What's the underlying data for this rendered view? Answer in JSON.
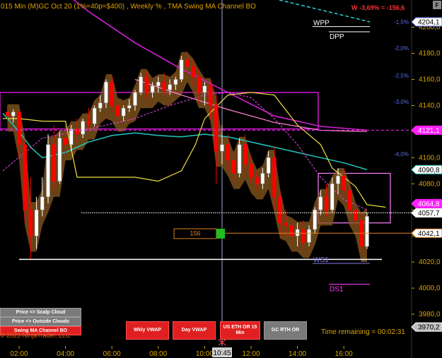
{
  "title": "015 Min (M)GC  Oct 20 (1%=40p=$400) , Weekly % , TMA Swing MA Channel BO",
  "performance": "W -3,69% = -156,6",
  "corner_label": "F",
  "copyright": "© 2023 NinjaTrader, LLC",
  "time_remaining": "Time remaining = 00:02:31",
  "buttons": {
    "scalp_cloud": "Price <> Scalp Cloud",
    "outside_clouds": "Price <> Outside Clouds",
    "swing_ma": "Swing MA Channel BO",
    "wkly_vwap": "Wkly VWAP",
    "day_vwap": "Day VWAP",
    "us_eth": "US ETH OR 15 Min",
    "gc_rth": "GC RTH OR"
  },
  "colors": {
    "background": "#000000",
    "axis_text": "#d9a400",
    "bull_candle": "#ffffff",
    "bear_candle": "#ff0000",
    "cloud": "#8b5a1e",
    "yellow_line": "#f0e040",
    "cyan_line": "#20c8c0",
    "magenta_line": "#d020d0",
    "pct_text": "#5b6cf0"
  },
  "chart_data": {
    "type": "candlestick",
    "y_ticks": [
      3980,
      4000,
      4020,
      4040,
      4060,
      4080,
      4100,
      4120,
      4140,
      4160,
      4180,
      4200
    ],
    "y_tick_labels": [
      "3980,0",
      "4000,0",
      "4020,0",
      "4040,0",
      "4060,0",
      "4080,0",
      "4100,0",
      "4120,0",
      "4140,0",
      "4160,0",
      "4180,0",
      "4200,0"
    ],
    "x_tick_labels": [
      "02:00",
      "04:00",
      "06:00",
      "08:00",
      "10:00",
      "12:00",
      "14:00",
      "16:00"
    ],
    "x_tick_hours": [
      2,
      4,
      6,
      8,
      10,
      12,
      14,
      16
    ],
    "crosshair": {
      "time": "10:45",
      "hour": 10.75
    },
    "price_flags": [
      {
        "label": "4204,1",
        "value": 4204.1,
        "bg": "#ffffff",
        "fg": "#000000",
        "border": "#5b6cf0"
      },
      {
        "label": "4121,1",
        "value": 4121.1,
        "bg": "#ff20ff",
        "fg": "#ffffff",
        "border": "#ff20ff"
      },
      {
        "label": "4090,8",
        "value": 4090.8,
        "bg": "#ffffff",
        "fg": "#000000",
        "border": "#20c8c0"
      },
      {
        "label": "4064,8",
        "value": 4064.8,
        "bg": "#ff20ff",
        "fg": "#ffffff",
        "border": "#ff20ff"
      },
      {
        "label": "4057,7",
        "value": 4057.7,
        "bg": "#ffffff",
        "fg": "#000000",
        "border": "#ffffff"
      },
      {
        "label": "4042,1",
        "value": 4042.1,
        "bg": "#ffffff",
        "fg": "#000000",
        "border": "#e08020"
      },
      {
        "label": "3970,2",
        "value": 3970.2,
        "bg": "#c0c0c0",
        "fg": "#000000",
        "border": "#ffffff"
      }
    ],
    "percent_levels": [
      {
        "label": "-1,5%",
        "value": 4204.1
      },
      {
        "label": "-2,0%",
        "value": 4184.0
      },
      {
        "label": "-2,5%",
        "value": 4163.0
      },
      {
        "label": "-3,0%",
        "value": 4143.0
      },
      {
        "label": "-4,0%",
        "value": 4103.0
      }
    ],
    "levels": [
      {
        "label": "WPP",
        "value": 4200.5,
        "color": "#ffffff"
      },
      {
        "label": "DPP",
        "value": 4196.5,
        "color": "#ffffff"
      },
      {
        "label": "WS1",
        "value": 4019.0,
        "color": "#8a7af0"
      },
      {
        "label": "DS1",
        "value": 4003.0,
        "color": "#ff40ff"
      }
    ],
    "range_box_label": "156",
    "candles": [
      {
        "t": 1.5,
        "o": 4135,
        "h": 4140,
        "c": 4132,
        "l": 4128
      },
      {
        "t": 1.75,
        "o": 4132,
        "h": 4137,
        "c": 4135,
        "l": 4127
      },
      {
        "t": 2.0,
        "o": 4135,
        "h": 4137,
        "c": 4110,
        "l": 4100
      },
      {
        "t": 2.25,
        "o": 4110,
        "h": 4115,
        "c": 4060,
        "l": 4050
      },
      {
        "t": 2.5,
        "o": 4060,
        "h": 4085,
        "c": 4040,
        "l": 4022
      },
      {
        "t": 2.75,
        "o": 4040,
        "h": 4070,
        "c": 4060,
        "l": 4030
      },
      {
        "t": 3.0,
        "o": 4060,
        "h": 4085,
        "c": 4070,
        "l": 4055
      },
      {
        "t": 3.25,
        "o": 4070,
        "h": 4118,
        "c": 4110,
        "l": 4065
      },
      {
        "t": 3.5,
        "o": 4110,
        "h": 4125,
        "c": 4082,
        "l": 4075
      },
      {
        "t": 3.75,
        "o": 4082,
        "h": 4120,
        "c": 4115,
        "l": 4080
      },
      {
        "t": 4.0,
        "o": 4115,
        "h": 4125,
        "c": 4110,
        "l": 4100
      },
      {
        "t": 4.25,
        "o": 4110,
        "h": 4125,
        "c": 4122,
        "l": 4105
      },
      {
        "t": 4.5,
        "o": 4122,
        "h": 4130,
        "c": 4118,
        "l": 4112
      },
      {
        "t": 4.75,
        "o": 4118,
        "h": 4130,
        "c": 4128,
        "l": 4115
      },
      {
        "t": 5.0,
        "o": 4128,
        "h": 4138,
        "c": 4126,
        "l": 4122
      },
      {
        "t": 5.25,
        "o": 4126,
        "h": 4140,
        "c": 4138,
        "l": 4124
      },
      {
        "t": 5.5,
        "o": 4138,
        "h": 4148,
        "c": 4142,
        "l": 4135
      },
      {
        "t": 5.75,
        "o": 4142,
        "h": 4160,
        "c": 4158,
        "l": 4138
      },
      {
        "t": 6.0,
        "o": 4158,
        "h": 4162,
        "c": 4140,
        "l": 4135
      },
      {
        "t": 6.25,
        "o": 4140,
        "h": 4145,
        "c": 4132,
        "l": 4128
      },
      {
        "t": 6.5,
        "o": 4132,
        "h": 4140,
        "c": 4138,
        "l": 4128
      },
      {
        "t": 6.75,
        "o": 4138,
        "h": 4145,
        "c": 4140,
        "l": 4135
      },
      {
        "t": 7.0,
        "o": 4140,
        "h": 4152,
        "c": 4150,
        "l": 4136
      },
      {
        "t": 7.25,
        "o": 4150,
        "h": 4165,
        "c": 4162,
        "l": 4148
      },
      {
        "t": 7.5,
        "o": 4162,
        "h": 4166,
        "c": 4150,
        "l": 4145
      },
      {
        "t": 7.75,
        "o": 4150,
        "h": 4158,
        "c": 4155,
        "l": 4146
      },
      {
        "t": 8.0,
        "o": 4155,
        "h": 4162,
        "c": 4158,
        "l": 4150
      },
      {
        "t": 8.25,
        "o": 4158,
        "h": 4165,
        "c": 4152,
        "l": 4148
      },
      {
        "t": 8.5,
        "o": 4152,
        "h": 4160,
        "c": 4156,
        "l": 4148
      },
      {
        "t": 8.75,
        "o": 4156,
        "h": 4162,
        "c": 4160,
        "l": 4152
      },
      {
        "t": 9.0,
        "o": 4160,
        "h": 4178,
        "c": 4175,
        "l": 4158
      },
      {
        "t": 9.25,
        "o": 4175,
        "h": 4180,
        "c": 4170,
        "l": 4162
      },
      {
        "t": 9.5,
        "o": 4170,
        "h": 4175,
        "c": 4162,
        "l": 4155
      },
      {
        "t": 9.75,
        "o": 4162,
        "h": 4168,
        "c": 4150,
        "l": 4142
      },
      {
        "t": 10.0,
        "o": 4150,
        "h": 4158,
        "c": 4155,
        "l": 4140
      },
      {
        "t": 10.25,
        "o": 4155,
        "h": 4158,
        "c": 4140,
        "l": 4130
      },
      {
        "t": 10.5,
        "o": 4140,
        "h": 4148,
        "c": 4105,
        "l": 4080
      },
      {
        "t": 10.75,
        "o": 4105,
        "h": 4125,
        "c": 4110,
        "l": 4095
      },
      {
        "t": 11.0,
        "o": 4110,
        "h": 4118,
        "c": 4098,
        "l": 4090
      },
      {
        "t": 11.25,
        "o": 4098,
        "h": 4105,
        "c": 4088,
        "l": 4080
      },
      {
        "t": 11.5,
        "o": 4088,
        "h": 4115,
        "c": 4110,
        "l": 4085
      },
      {
        "t": 11.75,
        "o": 4110,
        "h": 4118,
        "c": 4095,
        "l": 4088
      },
      {
        "t": 12.0,
        "o": 4095,
        "h": 4102,
        "c": 4085,
        "l": 4080
      },
      {
        "t": 12.25,
        "o": 4085,
        "h": 4090,
        "c": 4080,
        "l": 4075
      },
      {
        "t": 12.5,
        "o": 4080,
        "h": 4092,
        "c": 4088,
        "l": 4076
      },
      {
        "t": 12.75,
        "o": 4088,
        "h": 4105,
        "c": 4100,
        "l": 4085
      },
      {
        "t": 13.0,
        "o": 4100,
        "h": 4108,
        "c": 4070,
        "l": 4060
      },
      {
        "t": 13.25,
        "o": 4070,
        "h": 4075,
        "c": 4050,
        "l": 4040
      },
      {
        "t": 13.5,
        "o": 4050,
        "h": 4060,
        "c": 4048,
        "l": 4040
      },
      {
        "t": 13.75,
        "o": 4048,
        "h": 4052,
        "c": 4040,
        "l": 4032
      },
      {
        "t": 14.0,
        "o": 4040,
        "h": 4050,
        "c": 4045,
        "l": 4032
      },
      {
        "t": 14.25,
        "o": 4045,
        "h": 4052,
        "c": 4035,
        "l": 4030
      },
      {
        "t": 14.5,
        "o": 4035,
        "h": 4048,
        "c": 4045,
        "l": 4032
      },
      {
        "t": 14.75,
        "o": 4045,
        "h": 4062,
        "c": 4060,
        "l": 4042
      },
      {
        "t": 15.0,
        "o": 4060,
        "h": 4075,
        "c": 4070,
        "l": 4056
      },
      {
        "t": 15.25,
        "o": 4070,
        "h": 4080,
        "c": 4060,
        "l": 4055
      },
      {
        "t": 15.5,
        "o": 4060,
        "h": 4085,
        "c": 4080,
        "l": 4058
      },
      {
        "t": 15.75,
        "o": 4080,
        "h": 4092,
        "c": 4086,
        "l": 4072
      },
      {
        "t": 16.0,
        "o": 4086,
        "h": 4092,
        "c": 4075,
        "l": 4070
      },
      {
        "t": 16.25,
        "o": 4075,
        "h": 4082,
        "c": 4060,
        "l": 4055
      },
      {
        "t": 16.5,
        "o": 4060,
        "h": 4065,
        "c": 4052,
        "l": 4048
      },
      {
        "t": 16.75,
        "o": 4052,
        "h": 4058,
        "c": 4032,
        "l": 4028
      },
      {
        "t": 17.0,
        "o": 4032,
        "h": 4058,
        "c": 4055,
        "l": 4030
      }
    ]
  }
}
